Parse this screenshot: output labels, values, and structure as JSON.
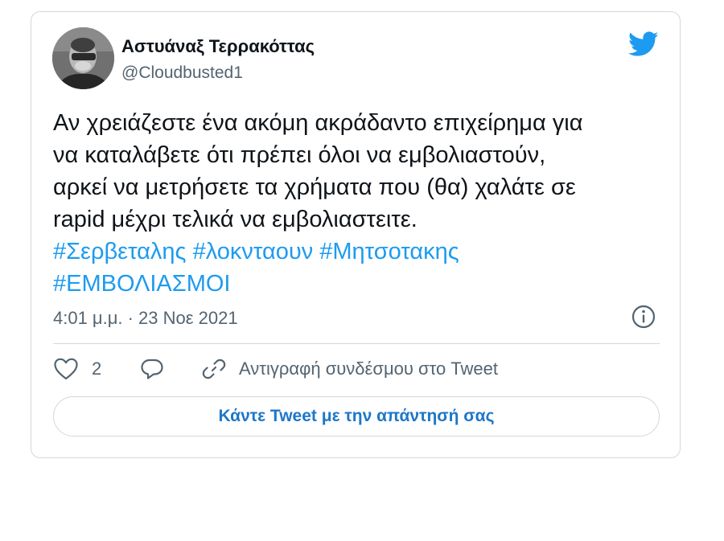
{
  "tweet": {
    "author": {
      "name": "Αστυάναξ Τερρακόττας",
      "handle": "@Cloudbusted1"
    },
    "text_lines": [
      "Αν χρειάζεστε ένα ακόμη ακράδαντο επιχείρημα για",
      "να καταλάβετε ότι πρέπει όλοι να εμβολιαστούν,",
      "αρκεί να μετρήσετε τα χρήματα που (θα) χαλάτε σε",
      "rapid μέχρι τελικά να εμβολιαστειτε."
    ],
    "hashtags": [
      "#Σερβεταλης",
      "#λοκνταουν",
      "#Μητσοτακης",
      "#ΕΜΒΟΛΙΑΣΜΟΙ"
    ],
    "timestamp": "4:01 μ.μ. · 23 Νοε 2021",
    "actions": {
      "like_count": "2",
      "copy_link_label": "Αντιγραφή συνδέσμου στο Tweet"
    },
    "reply_button_label": "Κάντε Tweet με την απάντησή σας"
  },
  "icons": {
    "brand": "twitter-bird-icon",
    "info": "info-icon",
    "like": "heart-icon",
    "reply": "speech-bubble-icon",
    "copy": "link-icon"
  },
  "colors": {
    "brand_blue": "#1d9bf0",
    "text": "#0f1419",
    "secondary_text": "#536471",
    "border": "#cfd9de",
    "reply_button_text": "#1d77c8"
  }
}
